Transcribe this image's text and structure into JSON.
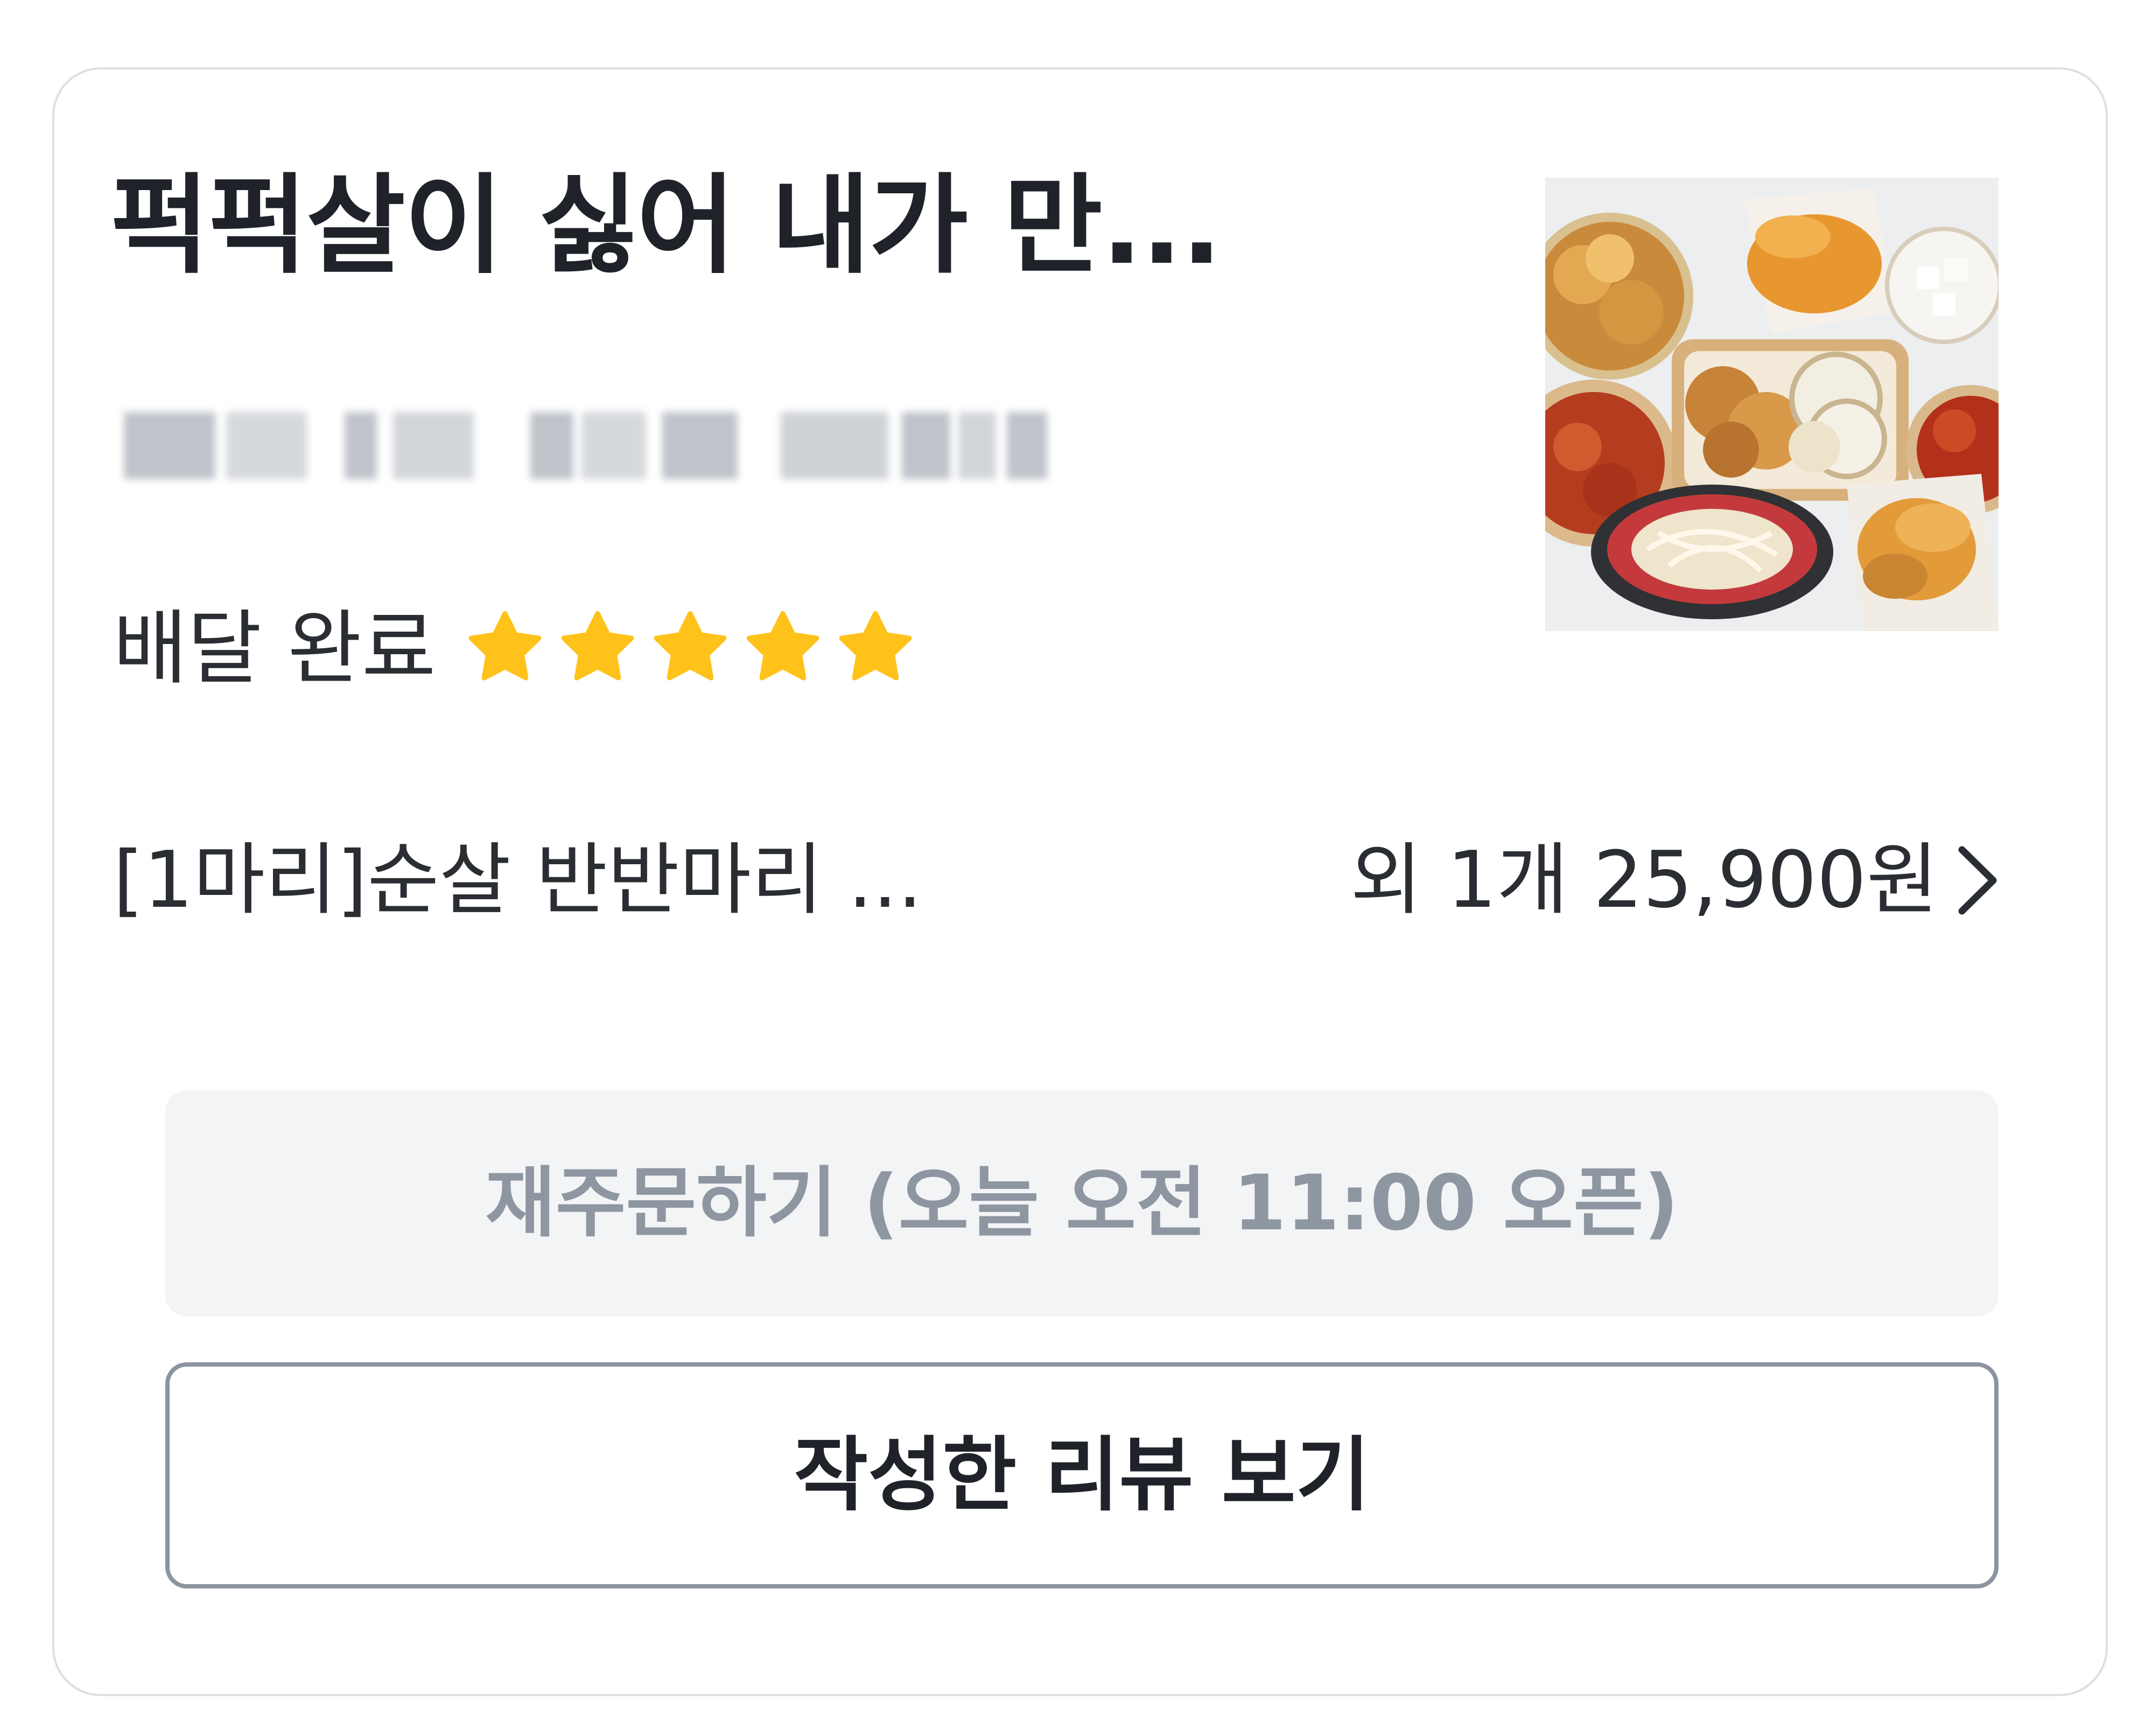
{
  "order_card": {
    "store_title": "퍽퍽살이 싫어 내가 만...",
    "status_text": "배달 완료",
    "rating": 5,
    "rating_max": 5,
    "star_color": "#ffc21a",
    "order_item_name": "[1마리]순살 반반마리 ...",
    "order_extra": "외 1개 25,900원",
    "reorder_label": "재주문하기 (오늘 오전 11:00 오픈)",
    "review_label": "작성한 리뷰 보기",
    "thumbnail_icon": "fried-chicken-photo",
    "chevron_icon": "chevron-right-icon"
  }
}
